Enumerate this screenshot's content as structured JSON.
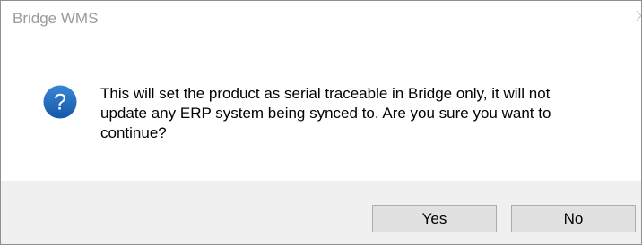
{
  "window": {
    "title": "Bridge WMS"
  },
  "dialog": {
    "icon": "question-icon",
    "icon_color": "#1c64b7",
    "message_lines": [
      "This will set the product as serial traceable in Bridge only, it will not",
      "update any ERP system being synced to. Are you sure you want to",
      "continue?"
    ]
  },
  "buttons": {
    "yes_label": "Yes",
    "no_label": "No"
  },
  "colors": {
    "footer_background": "#f0f0f0",
    "button_background": "#e1e1e1",
    "button_border": "#adadad",
    "title_text": "#9a9a9a"
  }
}
